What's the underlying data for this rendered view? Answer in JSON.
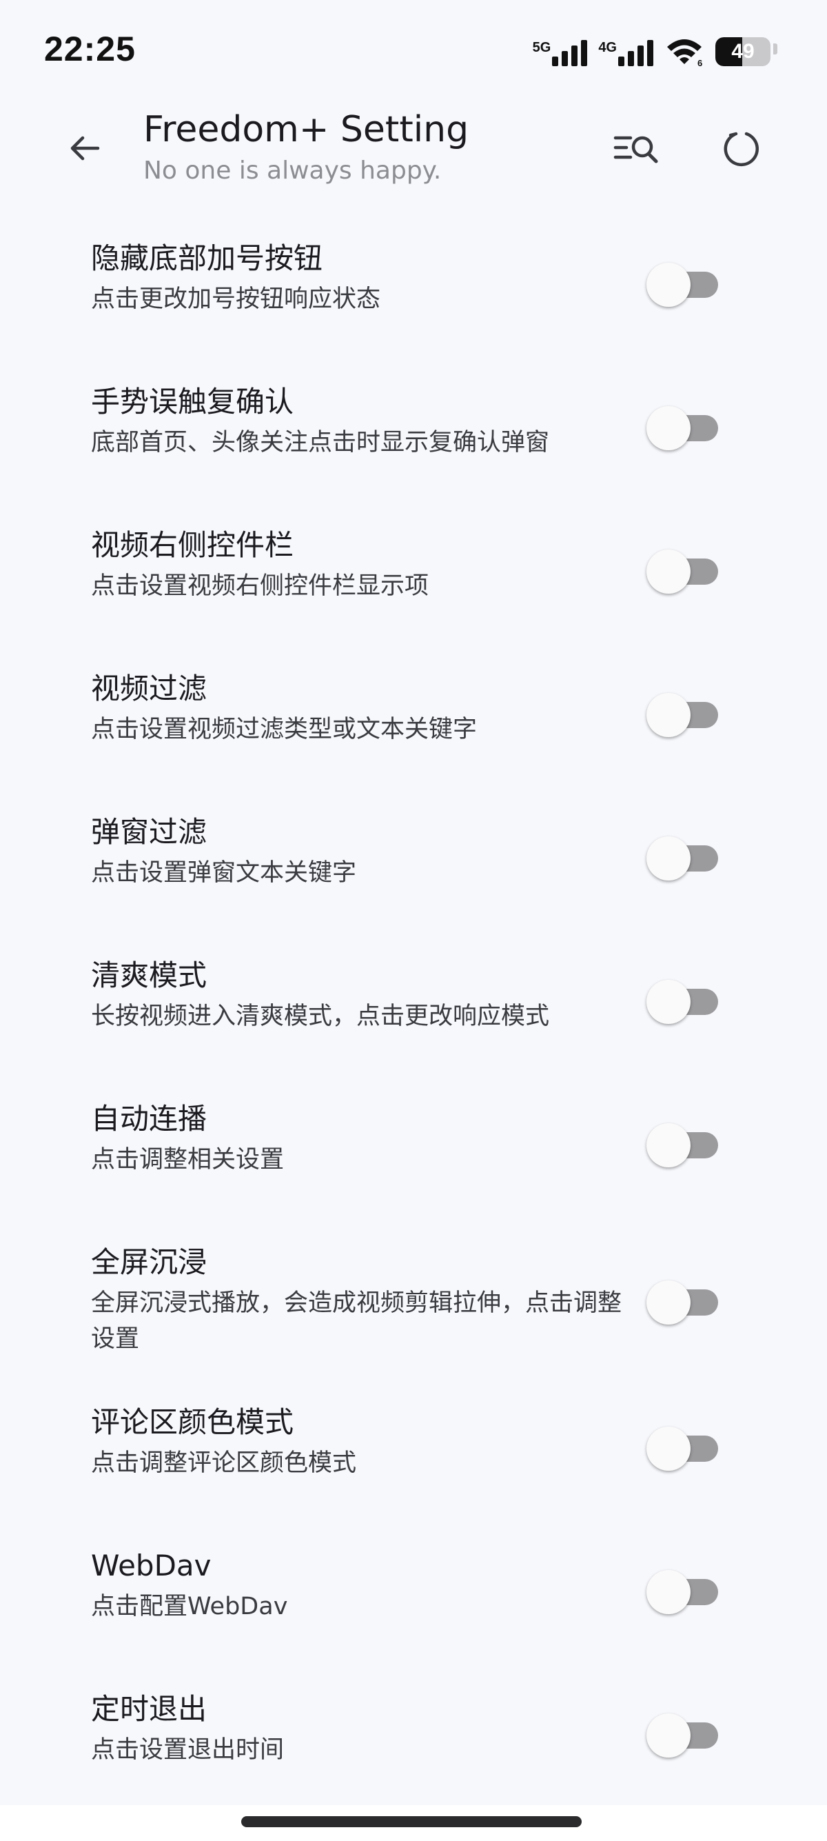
{
  "status_bar": {
    "time": "22:25",
    "network_1": "5G",
    "network_2": "4G",
    "wifi_badge": "6",
    "battery_percent": "49",
    "battery_level": 0.49
  },
  "app_bar": {
    "title": "Freedom+ Setting",
    "subtitle": "No one is always happy.",
    "back_icon": "arrow-back-icon",
    "search_icon": "list-search-icon",
    "refresh_icon": "refresh-icon"
  },
  "settings": [
    {
      "title": "隐藏底部加号按钮",
      "desc": "点击更改加号按钮响应状态",
      "enabled": false
    },
    {
      "title": "手势误触复确认",
      "desc": "底部首页、头像关注点击时显示复确认弹窗",
      "enabled": false
    },
    {
      "title": "视频右侧控件栏",
      "desc": "点击设置视频右侧控件栏显示项",
      "enabled": false
    },
    {
      "title": "视频过滤",
      "desc": "点击设置视频过滤类型或文本关键字",
      "enabled": false
    },
    {
      "title": "弹窗过滤",
      "desc": "点击设置弹窗文本关键字",
      "enabled": false
    },
    {
      "title": "清爽模式",
      "desc": "长按视频进入清爽模式，点击更改响应模式",
      "enabled": false
    },
    {
      "title": "自动连播",
      "desc": "点击调整相关设置",
      "enabled": false
    },
    {
      "title": "全屏沉浸",
      "desc": "全屏沉浸式播放，会造成视频剪辑拉伸，点击调整设置",
      "enabled": false
    },
    {
      "title": "评论区颜色模式",
      "desc": "点击调整评论区颜色模式",
      "enabled": false
    },
    {
      "title": "WebDav",
      "desc": "点击配置WebDav",
      "enabled": false
    },
    {
      "title": "定时退出",
      "desc": "点击设置退出时间",
      "enabled": false
    }
  ],
  "colors": {
    "background": "#f7f8fc",
    "switch_track_off": "#9b9b9e",
    "switch_thumb": "#fafafa"
  }
}
